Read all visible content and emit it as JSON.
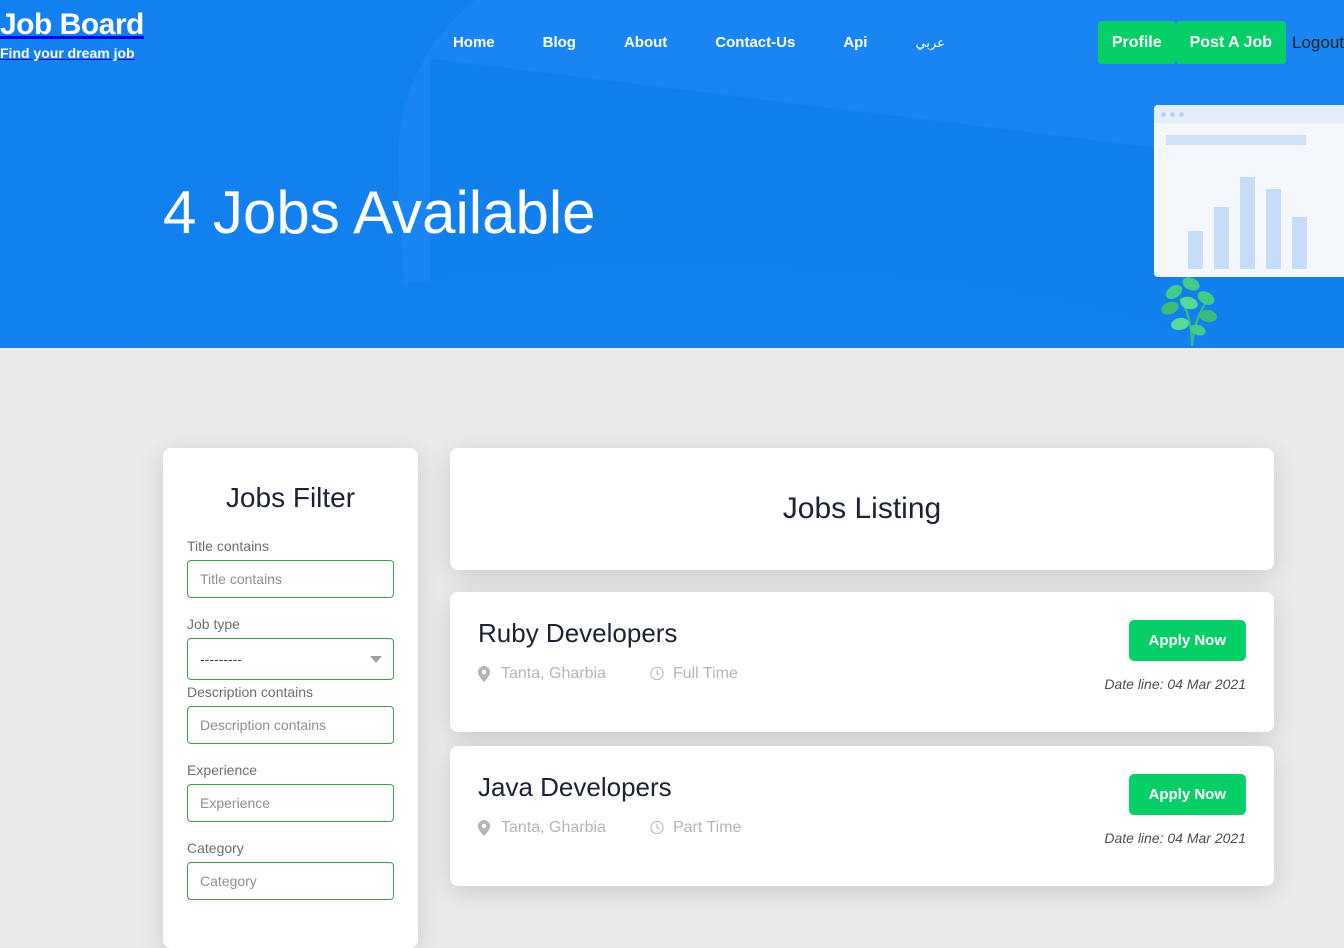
{
  "brand": {
    "title": "Job Board",
    "tagline": "Find your dream job"
  },
  "nav": {
    "items": [
      {
        "label": "Home",
        "name": "nav-home"
      },
      {
        "label": "Blog",
        "name": "nav-blog"
      },
      {
        "label": "About",
        "name": "nav-about"
      },
      {
        "label": "Contact-Us",
        "name": "nav-contact-us"
      },
      {
        "label": "Api",
        "name": "nav-api"
      },
      {
        "label": "عربي",
        "name": "nav-arabic"
      }
    ]
  },
  "auth": {
    "profile_label": "Profile",
    "post_job_label": "Post A Job",
    "logout_label": "Logout"
  },
  "hero": {
    "title": "4 Jobs Available"
  },
  "filter": {
    "title": "Jobs Filter",
    "fields": [
      {
        "label": "Title contains",
        "placeholder": "Title contains",
        "value": "",
        "type": "text",
        "name": "title-contains"
      },
      {
        "label": "Job type",
        "selected": "---------",
        "type": "select",
        "name": "job-type"
      },
      {
        "label": "Description contains",
        "placeholder": "Description contains",
        "value": "",
        "type": "text",
        "name": "description-contains"
      },
      {
        "label": "Experience",
        "placeholder": "Experience",
        "value": "",
        "type": "text",
        "name": "experience"
      },
      {
        "label": "Category",
        "placeholder": "Category",
        "value": "",
        "type": "text",
        "name": "category"
      }
    ]
  },
  "listing": {
    "title": "Jobs Listing",
    "apply_label": "Apply Now",
    "jobs": [
      {
        "title": "Ruby Developers",
        "location": "Tanta, Gharbia",
        "job_type": "Full Time",
        "deadline": "Date line: 04 Mar 2021"
      },
      {
        "title": "Java Developers",
        "location": "Tanta, Gharbia",
        "job_type": "Part Time",
        "deadline": "Date line: 04 Mar 2021"
      }
    ]
  },
  "colors": {
    "brand_blue": "#0d7ae8",
    "accent_green": "#06cf68",
    "field_border_green": "#3f9c48",
    "page_background": "#ebebeb",
    "heading_dark": "#1b2236"
  },
  "illustration": {
    "chart_bars": [
      38,
      62,
      92,
      80,
      52
    ]
  }
}
